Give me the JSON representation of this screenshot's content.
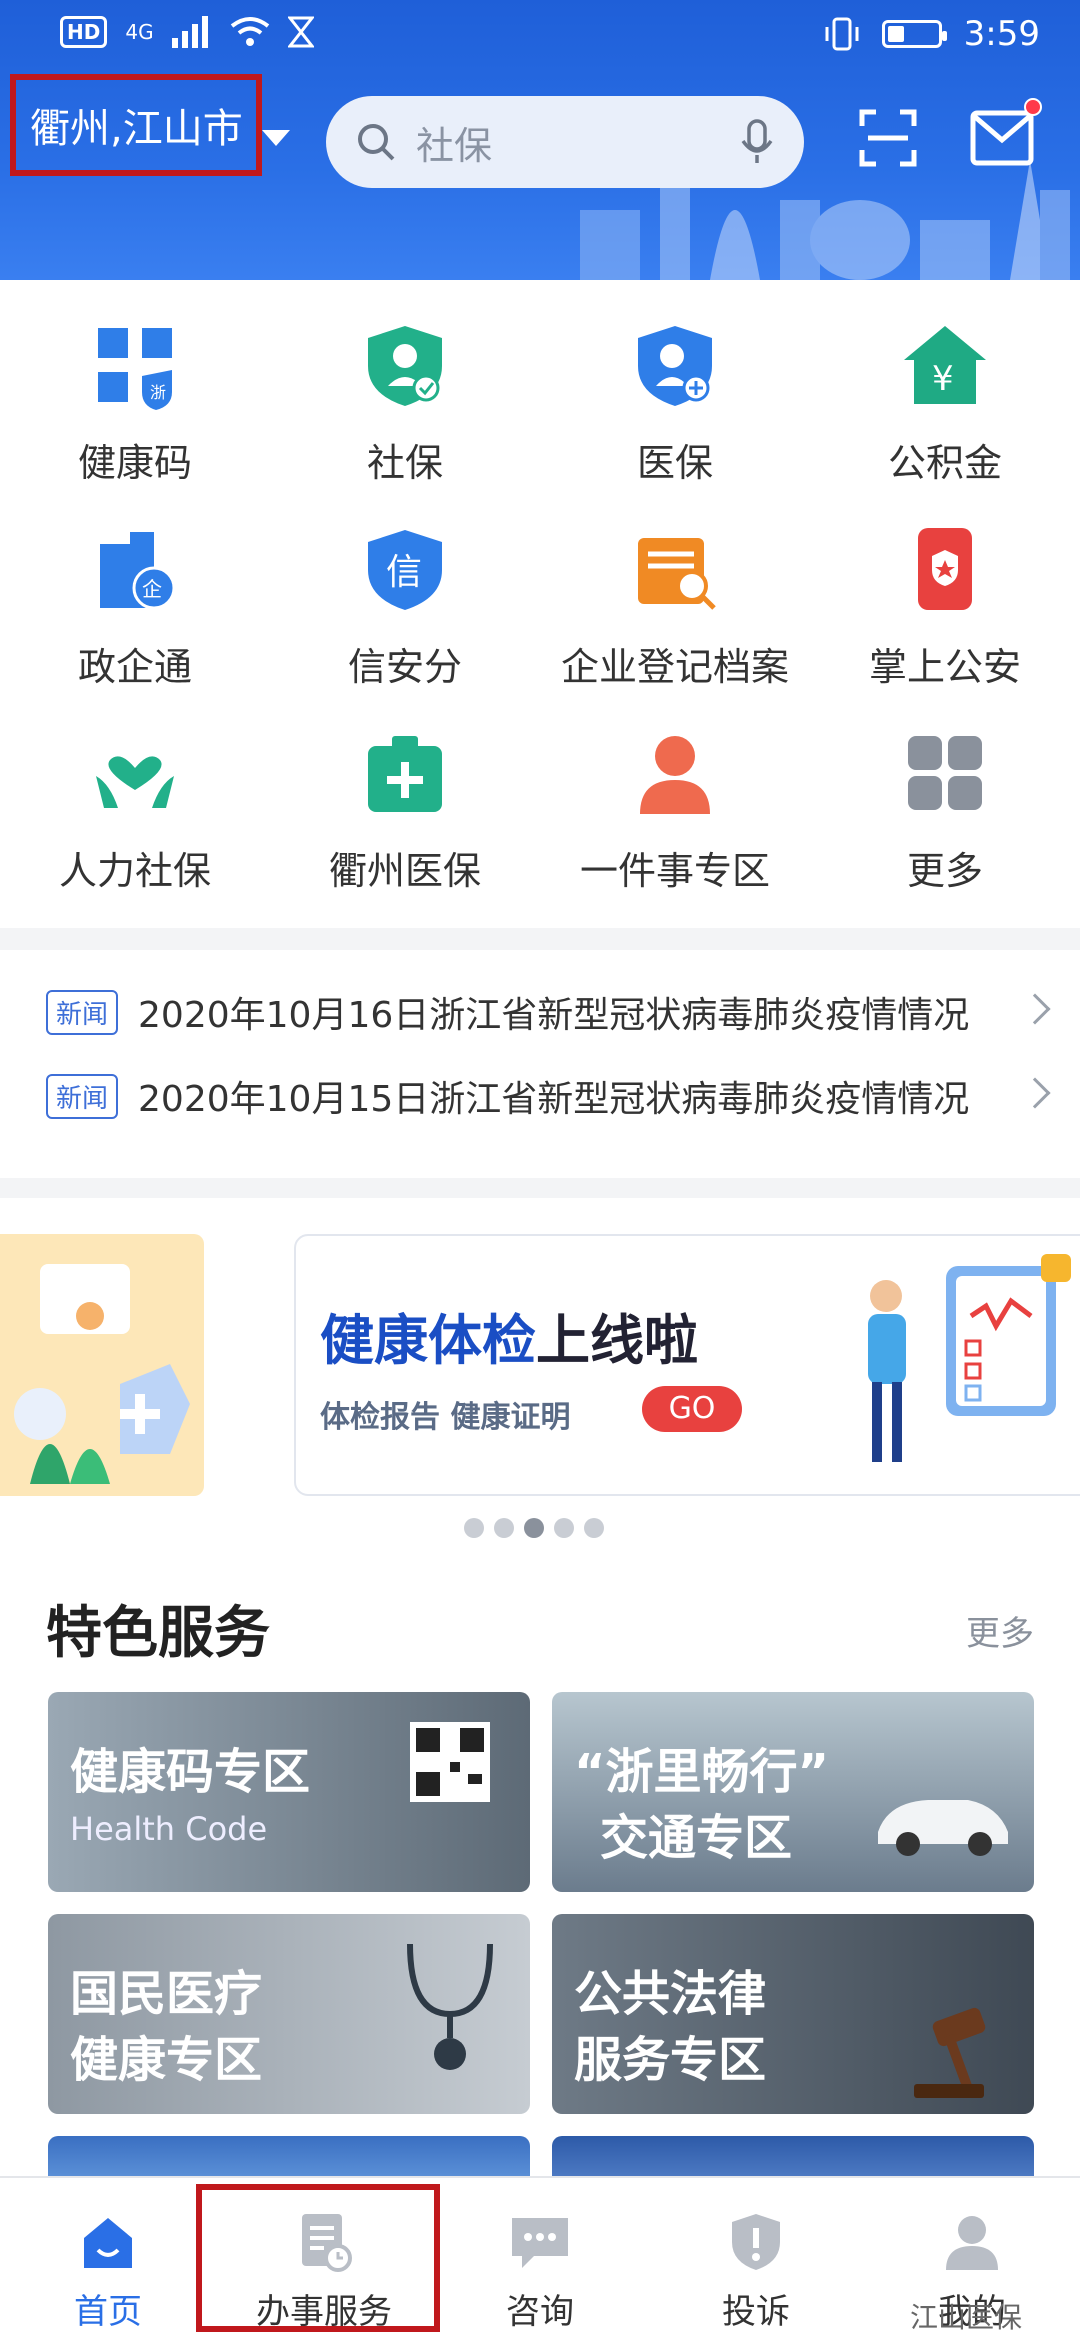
{
  "status_bar": {
    "network": "4G",
    "hd": "HD",
    "time": "3:59"
  },
  "header": {
    "location": "衢州,江山市",
    "search_placeholder": "社保",
    "scan_icon": "scan-icon",
    "mail_icon": "mail-icon"
  },
  "quick_services": [
    {
      "label": "健康码",
      "icon": "qr-health-icon",
      "color": "#2f7ee8"
    },
    {
      "label": "社保",
      "icon": "social-security-icon",
      "color": "#22b08a"
    },
    {
      "label": "医保",
      "icon": "medical-insurance-icon",
      "color": "#2f7ee8"
    },
    {
      "label": "公积金",
      "icon": "housing-fund-icon",
      "color": "#1faa84"
    },
    {
      "label": "政企通",
      "icon": "gov-enterprise-icon",
      "color": "#2f7ee8"
    },
    {
      "label": "信安分",
      "icon": "credit-shield-icon",
      "color": "#2f7ee8"
    },
    {
      "label": "企业登记档案",
      "icon": "enterprise-archive-icon",
      "color": "#f08a24"
    },
    {
      "label": "掌上公安",
      "icon": "police-icon",
      "color": "#e8413f"
    },
    {
      "label": "人力社保",
      "icon": "hands-heart-icon",
      "color": "#22b08a"
    },
    {
      "label": "衢州医保",
      "icon": "medical-kit-icon",
      "color": "#22b08a"
    },
    {
      "label": "一件事专区",
      "icon": "person-icon",
      "color": "#ef6a4e"
    },
    {
      "label": "更多",
      "icon": "more-grid-icon",
      "color": "#8a919c"
    }
  ],
  "news": [
    {
      "tag": "新闻",
      "text": "2020年10月16日浙江省新型冠状病毒肺炎疫情情况"
    },
    {
      "tag": "新闻",
      "text": "2020年10月15日浙江省新型冠状病毒肺炎疫情情况"
    }
  ],
  "banner": {
    "title_blue": "健康体检",
    "title_dark": "上线啦",
    "subtitle": "体检报告  健康证明",
    "cta": "GO",
    "page_count": 5,
    "active_page": 3
  },
  "featured": {
    "title": "特色服务",
    "more": "更多",
    "tiles": [
      {
        "line1": "健康码专区",
        "line2": "Health Code",
        "bg": "#7d8c99"
      },
      {
        "line1": "“浙里畅行”",
        "line2": "交通专区",
        "bg": "#6b7c8d"
      },
      {
        "line1": "国民医疗",
        "line2": "健康专区",
        "bg": "#9aa4ae"
      },
      {
        "line1": "公共法律",
        "line2": "服务专区",
        "bg": "#5f6b78"
      }
    ]
  },
  "bottom_nav": [
    {
      "label": "首页",
      "icon": "home-icon",
      "active": true
    },
    {
      "label": "办事服务",
      "icon": "service-doc-icon",
      "active": false
    },
    {
      "label": "咨询",
      "icon": "chat-icon",
      "active": false
    },
    {
      "label": "投诉",
      "icon": "complaint-shield-icon",
      "active": false
    },
    {
      "label": "我的",
      "icon": "profile-icon",
      "active": false
    }
  ],
  "watermark": "江山医保",
  "colors": {
    "brand": "#2a6fe6",
    "highlight": "#c0181c"
  }
}
